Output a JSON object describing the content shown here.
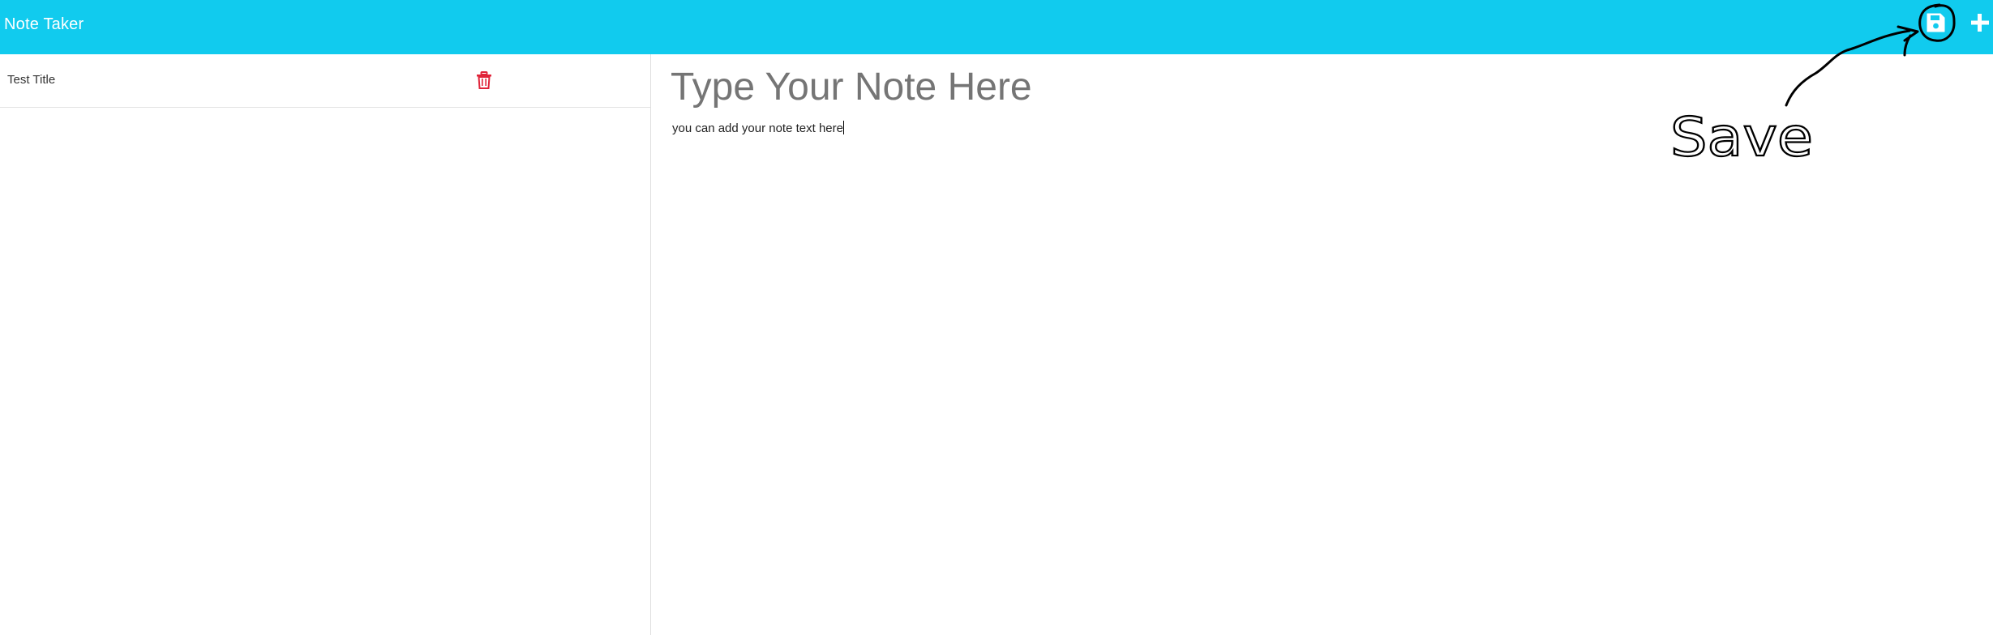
{
  "navbar": {
    "brand": "Note Taker",
    "save_icon": "floppy-disk-icon",
    "new_icon": "plus-icon",
    "background_color": "#11cbee"
  },
  "notes_list": {
    "items": [
      {
        "title": "Test Title",
        "delete_icon": "trash-icon",
        "delete_color": "#e0243a"
      }
    ]
  },
  "editor": {
    "title_placeholder": "Type Your Note Here",
    "text_value": "you can add your note text here"
  },
  "annotation": {
    "label": "Save"
  }
}
